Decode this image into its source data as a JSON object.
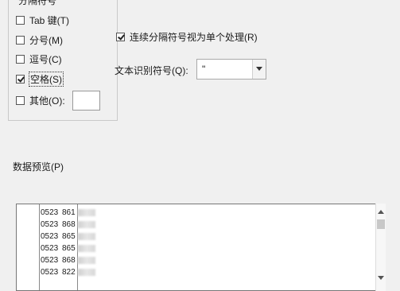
{
  "delimiters": {
    "legend": "分隔符号",
    "options": [
      {
        "label": "Tab 键(T)",
        "checked": false
      },
      {
        "label": "分号(M)",
        "checked": false
      },
      {
        "label": "逗号(C)",
        "checked": false
      },
      {
        "label": "空格(S)",
        "checked": true
      },
      {
        "label": "其他(O):",
        "checked": false
      }
    ],
    "other_value": ""
  },
  "consecutive": {
    "label": "连续分隔符号视为单个处理(R)",
    "checked": true
  },
  "qualifier": {
    "label": "文本识别符号(Q):",
    "value": "\""
  },
  "preview": {
    "label": "数据预览(P)",
    "rows": [
      {
        "c1": "0523",
        "c2": "861"
      },
      {
        "c1": "0523",
        "c2": "868"
      },
      {
        "c1": "0523",
        "c2": "865"
      },
      {
        "c1": "0523",
        "c2": "865"
      },
      {
        "c1": "0523",
        "c2": "868"
      },
      {
        "c1": "0523",
        "c2": "822"
      }
    ]
  }
}
